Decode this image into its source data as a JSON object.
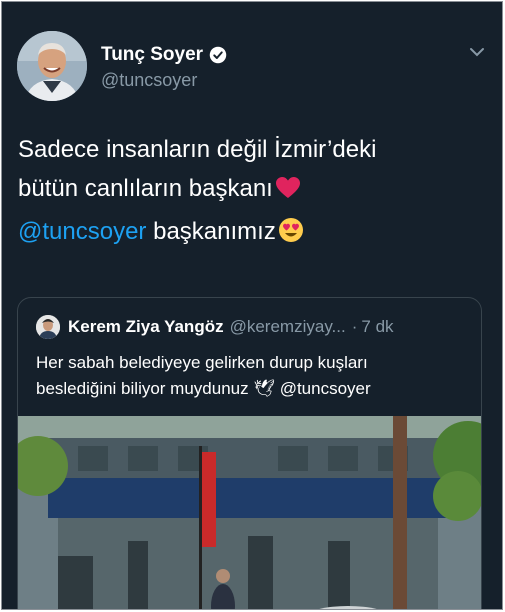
{
  "author": {
    "name": "Tunç Soyer",
    "handle": "@tuncsoyer",
    "verified": true
  },
  "icons": {
    "verified": "verified-badge-icon",
    "menu": "chevron-down-icon"
  },
  "tweet": {
    "line1": "Sadece insanların değil İzmir’deki",
    "line2": "bütün canlıların başkanı",
    "emoji_heart": "❤️",
    "mention": "@tuncsoyer",
    "line3_rest": "başkanımız",
    "emoji_love": "😍"
  },
  "quoted": {
    "name": "Kerem Ziya Yangöz",
    "handle": "@keremziyay...",
    "dot": "·",
    "time": "7 dk",
    "line1": "Her sabah belediyeye gelirken durup kuşları",
    "line2": "beslediğini biliyor muydunuz",
    "dove": "🕊",
    "mention": "@tuncsoyer"
  },
  "colors": {
    "background": "#15202b",
    "link": "#1da1f2",
    "secondary": "#8899a6",
    "border": "#38444d"
  }
}
